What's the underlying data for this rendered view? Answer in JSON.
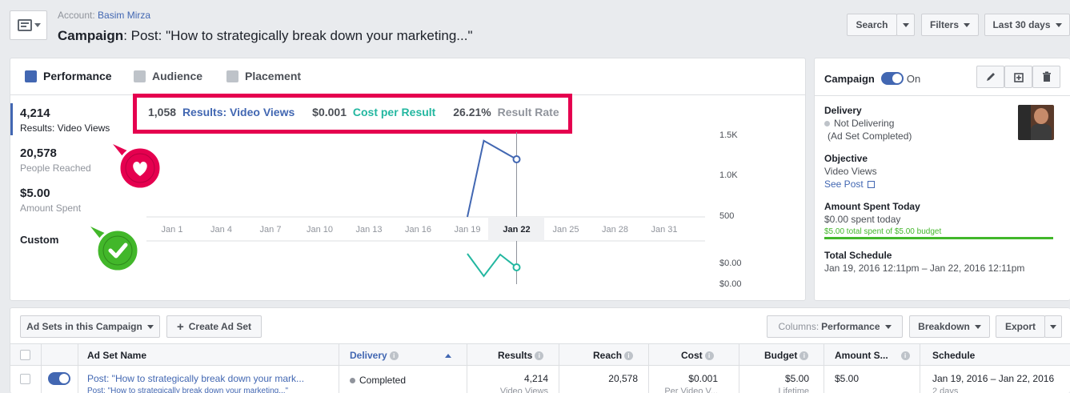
{
  "header": {
    "account_label": "Account:",
    "account_name": "Basim Mirza",
    "campaign_label": "Campaign",
    "campaign_title": ": Post: \"How to strategically break down your marketing...\"",
    "search_label": "Search",
    "filters_label": "Filters",
    "date_range_label": "Last 30 days"
  },
  "tabs": [
    {
      "label": "Performance"
    },
    {
      "label": "Audience"
    },
    {
      "label": "Placement"
    }
  ],
  "metrics": [
    {
      "value": "4,214",
      "label": "Results: Video Views"
    },
    {
      "value": "20,578",
      "label": "People Reached"
    },
    {
      "value": "$5.00",
      "label": "Amount Spent"
    },
    {
      "value": "Custom",
      "label": ""
    }
  ],
  "summary": {
    "results_value": "1,058",
    "results_label": "Results: Video Views",
    "cost_value": "$0.001",
    "cost_label": "Cost per Result",
    "rate_value": "26.21%",
    "rate_label": "Result Rate"
  },
  "chart_data": {
    "type": "line",
    "x": [
      "Jan 1",
      "Jan 4",
      "Jan 7",
      "Jan 10",
      "Jan 13",
      "Jan 16",
      "Jan 19",
      "Jan 22",
      "Jan 25",
      "Jan 28",
      "Jan 31"
    ],
    "highlighted_x": "Jan 22",
    "upper": {
      "y_ticks": [
        "1.5K",
        "1.0K",
        "500"
      ],
      "points": [
        {
          "x": "Jan 19",
          "y": 0
        },
        {
          "x": "Jan 20",
          "y": 1400
        },
        {
          "x": "Jan 22",
          "y": 1058
        }
      ],
      "color": "#4267b2"
    },
    "lower": {
      "y_ticks": [
        "$0.00",
        "$0.00"
      ],
      "color": "#23b7a0"
    }
  },
  "right_panel": {
    "campaign_label": "Campaign",
    "toggle_state": "On",
    "delivery_title": "Delivery",
    "delivery_status": "Not Delivering",
    "delivery_note": "(Ad Set Completed)",
    "objective_title": "Objective",
    "objective_value": "Video Views",
    "see_post_label": "See Post",
    "amount_title": "Amount Spent Today",
    "amount_today": "$0.00 spent today",
    "budget_note": "$5.00 total spent of $5.00 budget",
    "budget_fraction": 1.0,
    "schedule_title": "Total Schedule",
    "schedule_value": "Jan 19, 2016 12:11pm – Jan 22, 2016 12:11pm"
  },
  "toolbar": {
    "adsets_label": "Ad Sets in this Campaign",
    "create_label": "Create Ad Set",
    "columns_prefix": "Columns:",
    "columns_value": "Performance",
    "breakdown_label": "Breakdown",
    "export_label": "Export"
  },
  "table": {
    "headers": {
      "name": "Ad Set Name",
      "delivery": "Delivery",
      "results": "Results",
      "reach": "Reach",
      "cost": "Cost",
      "budget": "Budget",
      "amount": "Amount S...",
      "schedule": "Schedule"
    },
    "rows": [
      {
        "name": "Post: \"How to strategically break down your mark...",
        "name_sub": "Post: \"How to strategically break down your marketing...\"",
        "delivery": "Completed",
        "results": "4,214",
        "results_sub": "Video Views",
        "reach": "20,578",
        "cost": "$0.001",
        "cost_sub": "Per Video V...",
        "budget": "$5.00",
        "budget_sub": "Lifetime",
        "amount": "$5.00",
        "schedule": "Jan 19, 2016 – Jan 22, 2016",
        "schedule_sub": "2 days"
      }
    ]
  },
  "colors": {
    "accent": "#4267b2",
    "teal": "#23b7a0",
    "highlight_box": "#e5004f",
    "green": "#42b72a"
  }
}
